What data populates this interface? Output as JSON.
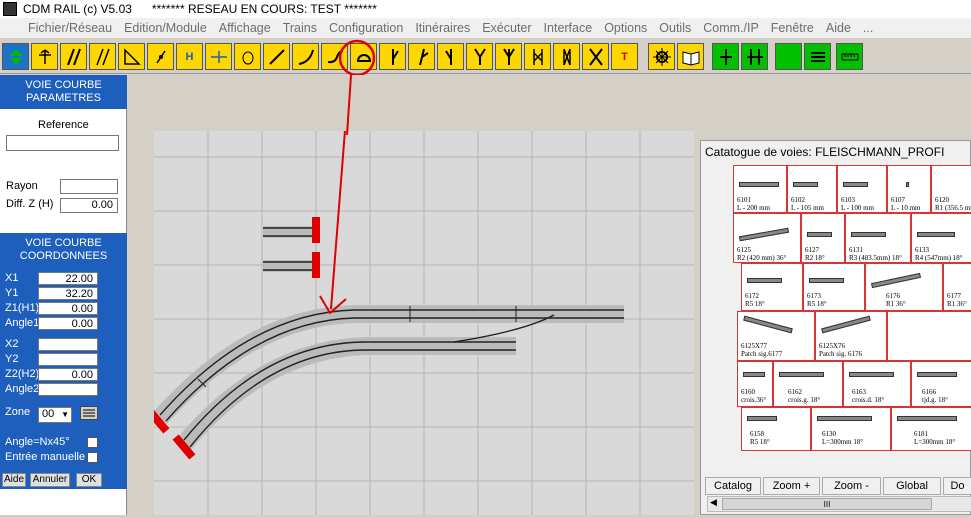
{
  "app": {
    "title": "CDM RAIL (c) V5.03      ******* RESEAU EN COURS: TEST *******"
  },
  "menu": [
    "Fichier/Réseau",
    "Edition/Module",
    "Affichage",
    "Trains",
    "Configuration",
    "Itinéraires",
    "Exécuter",
    "Interface",
    "Options",
    "Outils",
    "Comm./IP",
    "Fenêtre",
    "Aide",
    "..."
  ],
  "toolbar": {
    "items": [
      "move",
      "figure",
      "double-track",
      "set-square",
      "point",
      "hi",
      "h-line",
      "mouse",
      "straight",
      "curve",
      "circle-curve",
      "turnout-l",
      "turnout-f",
      "turnout-y",
      "turnout-w",
      "turnout-3w",
      "crossing",
      "crossing-2",
      "x",
      "signal-t",
      "settings",
      "book",
      "green-left",
      "green-right",
      "green",
      "menu-lines",
      "ruler"
    ],
    "h_label": "H"
  },
  "params": {
    "title": "VOIE COURBE\nPARAMETRES",
    "reference_label": "Reference",
    "reference_value": "",
    "rayon_label": "Rayon",
    "rayon_value": "",
    "diffz_label": "Diff. Z (H)",
    "diffz_value": "0.00"
  },
  "coords": {
    "title": "VOIE COURBE\nCOORDONNEES",
    "x1_label": "X1",
    "x1_value": "22.00",
    "y1_label": "Y1",
    "y1_value": "32.20",
    "z1_label": "Z1(H1)",
    "z1_value": "0.00",
    "angle1_label": "Angle1",
    "angle1_value": "0.00",
    "x2_label": "X2",
    "x2_value": "",
    "y2_label": "Y2",
    "y2_value": "",
    "z2_label": "Z2(H2)",
    "z2_value": "0.00",
    "angle2_label": "Angle2",
    "angle2_value": "",
    "zone_label": "Zone",
    "zone_value": "00",
    "anglenx_label": "Angle=Nx45°",
    "entree_label": "Entrée manuelle"
  },
  "buttons": {
    "aide": "Aide",
    "annuler": "Annuler",
    "ok": "OK"
  },
  "catalog": {
    "title": "Catatogue de voies: FLEISCHMANN_PROFI",
    "rows": [
      [
        {
          "code": "6101",
          "desc": "L - 200 mm"
        },
        {
          "code": "6102",
          "desc": "L - 105 mm"
        },
        {
          "code": "6103",
          "desc": "L - 100 mm"
        },
        {
          "code": "6107",
          "desc": "L - 10 mm"
        },
        {
          "code": "6120",
          "desc": "R1 (356.5 mm"
        }
      ],
      [
        {
          "code": "6125",
          "desc": "R2 (420 mm) 36°"
        },
        {
          "code": "6127",
          "desc": "R2 18°"
        },
        {
          "code": "6131",
          "desc": "R3 (483.5mm) 18°"
        },
        {
          "code": "6133",
          "desc": "R4 (547mm) 18°"
        }
      ],
      [
        {
          "code": "6172",
          "desc": "R5 18°"
        },
        {
          "code": "6173",
          "desc": "R5 18°"
        },
        {
          "code": "6176",
          "desc": "R1 36°"
        },
        {
          "code": "6177",
          "desc": "R1 36°"
        }
      ],
      [
        {
          "code": "6125X77",
          "desc": "Patch sig.6177"
        },
        {
          "code": "6125X76",
          "desc": "Patch sig. 6176"
        }
      ],
      [
        {
          "code": "6160",
          "desc": "crois.36°"
        },
        {
          "code": "6162",
          "desc": "crois.g. 18°"
        },
        {
          "code": "6163",
          "desc": "crois.d. 18°"
        },
        {
          "code": "6166",
          "desc": "tjd.g. 18°"
        }
      ],
      [
        {
          "code": "6158",
          "desc": "R5 18°"
        },
        {
          "code": "6130",
          "desc": "L=300mm 18°"
        },
        {
          "code": "6181",
          "desc": "L=300mm 18°"
        }
      ]
    ],
    "buttons": [
      "Catalog",
      "Zoom +",
      "Zoom -",
      "Global",
      "Do"
    ],
    "scroll_label": "III"
  },
  "colors": {
    "accent_blue": "#1e5ebc",
    "highlight_red": "#e00000",
    "tool_yellow": "#ffd700"
  }
}
